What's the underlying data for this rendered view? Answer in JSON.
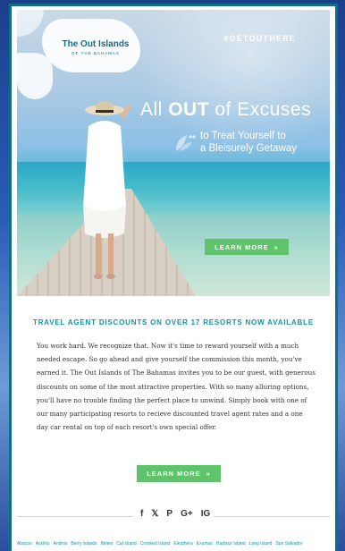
{
  "hero": {
    "logo_title": "The Out Islands",
    "logo_subtitle": "OF THE BAHAMAS",
    "hashtag": "#GETOUTHERE",
    "headline_pre": "All ",
    "headline_strong": "OUT",
    "headline_post": " of Excuses",
    "subhead_line1": "to Treat Yourself to",
    "subhead_line2": "a Bleisurely Getaway",
    "cta_label": "LEARN MORE",
    "cta_chevrons": "»"
  },
  "content": {
    "section_title": "TRAVEL AGENT DISCOUNTS ON OVER 17 RESORTS NOW AVAILABLE",
    "body": "You work hard. We recognize that. Now it's time to reward yourself with a much needed escape. So go ahead and give yourself the commission this month, you've earned it. The Out Islands of The Bahamas invites you to be our guest, with generous discounts on some of the most attractive properties. With so many alluring options, you'll have no trouble finding the perfect place to unwind. Simply book with one of our many participating resorts to recieve discounted travel agent rates and a one day car rental on top of each resort's own special offer.",
    "cta_label": "LEARN MORE",
    "cta_chevrons": "»"
  },
  "social": {
    "icons": [
      "f",
      "𝕏",
      "P",
      "G+",
      "IG"
    ]
  },
  "footer": {
    "islands": [
      "Abacos",
      "Acklins",
      "Andros",
      "Berry Islands",
      "Bimini",
      "Cat Island",
      "Crooked Island",
      "Eleuthera",
      "Exumas",
      "Harbour Island",
      "Long Island",
      "San Salvador"
    ]
  },
  "colors": {
    "accent": "#0f93b2",
    "button": "#5fc36c",
    "frame": "#0b6f86"
  }
}
